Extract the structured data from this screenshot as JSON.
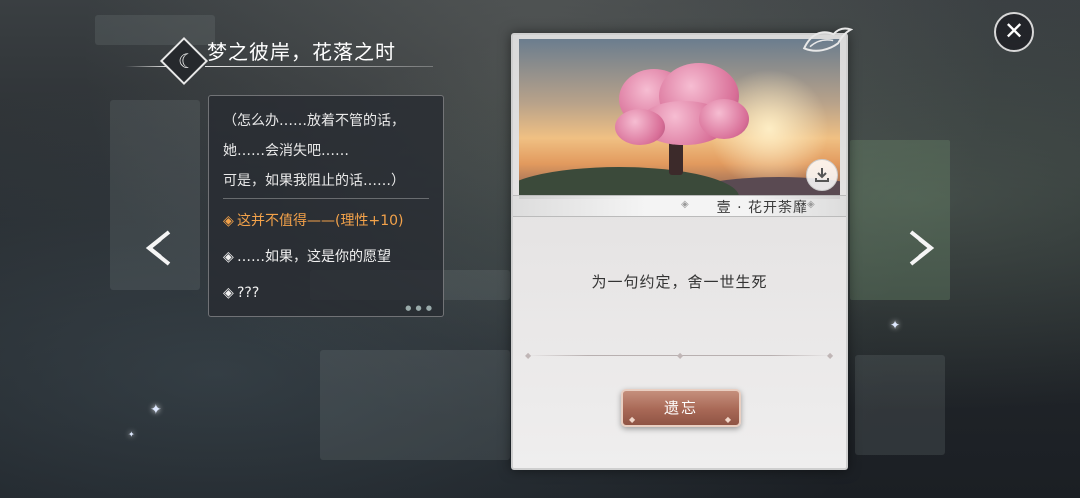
{
  "title": "梦之彼岸，花落之时",
  "dialogue": {
    "lines": [
      "（怎么办……放着不管的话，",
      "她……会消失吧……",
      "可是，如果我阻止的话……）"
    ],
    "choices": [
      {
        "label": "这并不值得——(理性+10)",
        "selected": true
      },
      {
        "label": "……如果，这是你的愿望",
        "selected": false
      },
      {
        "label": "???",
        "selected": false
      }
    ]
  },
  "card": {
    "chapter": "壹 · 花开荼靡",
    "description": "为一句约定，舍一世生死",
    "button_label": "遗忘"
  },
  "colors": {
    "selected_choice": "#f3a24a",
    "button": "#a86856"
  },
  "icons": {
    "emblem": "crescent-moon-icon",
    "close": "close-icon",
    "prev": "chevron-left-icon",
    "next": "chevron-right-icon",
    "download": "download-icon",
    "decoration": "bird-icon"
  }
}
